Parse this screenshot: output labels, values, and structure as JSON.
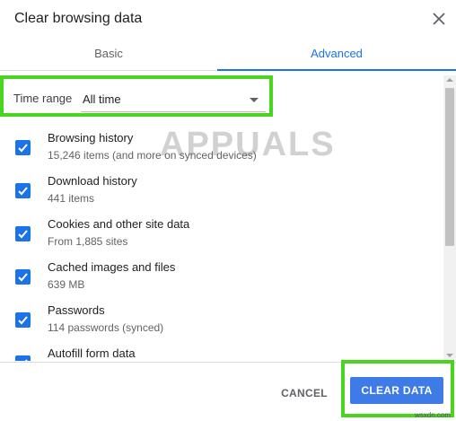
{
  "dialog": {
    "title": "Clear browsing data",
    "tabs": [
      {
        "label": "Basic"
      },
      {
        "label": "Advanced"
      }
    ],
    "time_range": {
      "label": "Time range",
      "value": "All time"
    },
    "items": [
      {
        "title": "Browsing history",
        "subtitle": "15,246 items (and more on synced devices)",
        "checked": true
      },
      {
        "title": "Download history",
        "subtitle": "441 items",
        "checked": true
      },
      {
        "title": "Cookies and other site data",
        "subtitle": "From 1,885 sites",
        "checked": true
      },
      {
        "title": "Cached images and files",
        "subtitle": "639 MB",
        "checked": true
      },
      {
        "title": "Passwords",
        "subtitle": "114 passwords (synced)",
        "checked": true
      },
      {
        "title": "Autofill form data",
        "subtitle": "",
        "checked": true
      }
    ],
    "buttons": {
      "cancel": "CANCEL",
      "clear": "CLEAR DATA"
    }
  },
  "watermark": {
    "brand": "APPUALS",
    "site": "wsxdn.com"
  },
  "colors": {
    "accent": "#1a73e8",
    "highlight_border": "#49d51e",
    "clear_button": "#3e7be6"
  },
  "icons": {
    "close": "close-icon",
    "dropdown": "chevron-down-icon",
    "checkbox": "checkmark-icon"
  }
}
